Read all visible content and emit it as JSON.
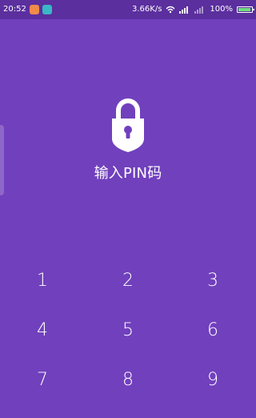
{
  "status_bar": {
    "time": "20:52",
    "network_speed": "3.66K/s",
    "battery_percent": "100%",
    "icons": {
      "app1": "orange-app-icon",
      "app2": "teal-app-icon",
      "wifi": "wifi-icon",
      "signal1": "signal-icon",
      "signal2": "signal-icon",
      "battery": "battery-icon"
    }
  },
  "lock_screen": {
    "title": "输入PIN码",
    "lock_icon": "lock-icon"
  },
  "keypad": {
    "keys": [
      "1",
      "2",
      "3",
      "4",
      "5",
      "6",
      "7",
      "8",
      "9"
    ]
  },
  "colors": {
    "background": "#7140bd",
    "status_bar": "#5b2f9e",
    "text": "#ffffff"
  }
}
